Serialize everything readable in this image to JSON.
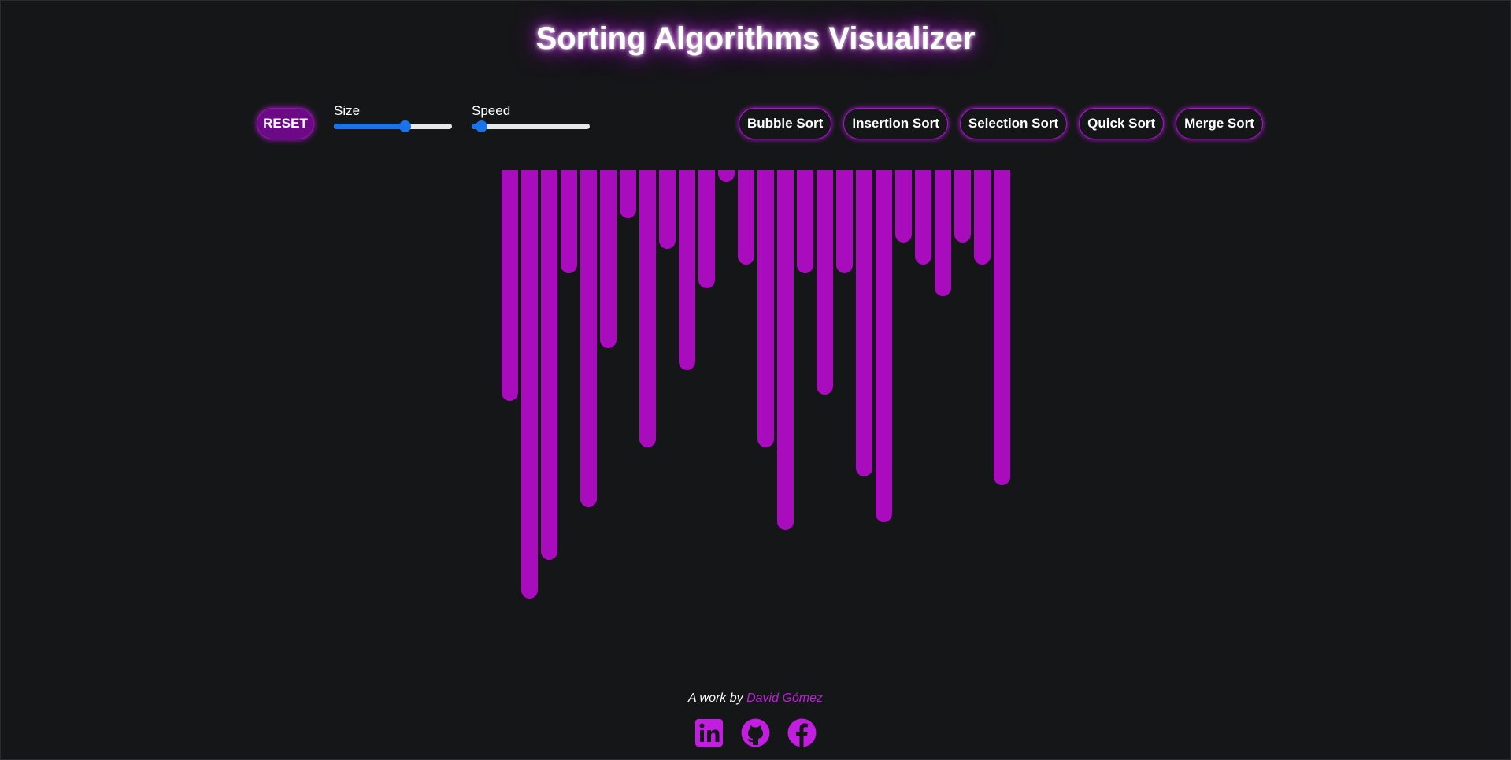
{
  "header": {
    "title": "Sorting Algorithms Visualizer"
  },
  "controls": {
    "reset_label": "RESET",
    "size": {
      "label": "Size",
      "value_fraction": 0.6
    },
    "speed": {
      "label": "Speed",
      "value_fraction": 0.08
    }
  },
  "algorithms": [
    {
      "label": "Bubble Sort"
    },
    {
      "label": "Insertion Sort"
    },
    {
      "label": "Selection Sort"
    },
    {
      "label": "Quick Sort"
    },
    {
      "label": "Merge Sort"
    }
  ],
  "array": {
    "bar_color": "#a90cbd",
    "values": [
      293,
      544,
      495,
      131,
      428,
      226,
      61,
      352,
      100,
      254,
      150,
      15,
      120,
      352,
      457,
      131,
      285,
      131,
      389,
      447,
      92,
      120,
      160,
      92,
      120,
      400
    ]
  },
  "footer": {
    "prefix": "A work by",
    "author": "David Gómez"
  },
  "socials": [
    {
      "icon": "linkedin-icon"
    },
    {
      "icon": "github-icon"
    },
    {
      "icon": "facebook-icon"
    }
  ],
  "colors": {
    "background": "#151618",
    "accent": "#a90cbd",
    "slider": "#1a73e8"
  }
}
